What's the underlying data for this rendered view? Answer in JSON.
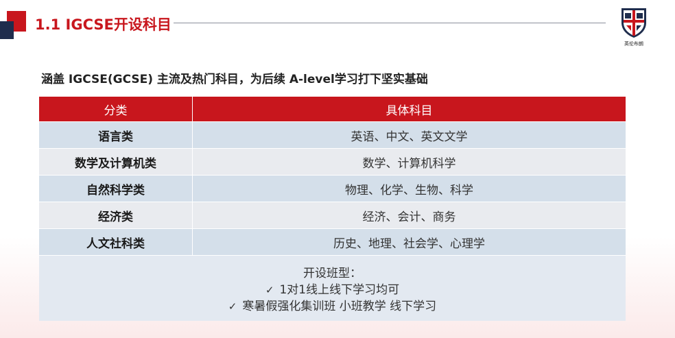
{
  "header": {
    "title": "1.1 IGCSE开设科目",
    "logo_text": "英伦布朗"
  },
  "subtitle": "涵盖 IGCSE(GCSE) 主流及热门科目，为后续 A-level学习打下坚实基础",
  "table": {
    "headers": [
      "分类",
      "具体科目"
    ],
    "rows": [
      {
        "category": "语言类",
        "subjects": "英语、中文、英文文学"
      },
      {
        "category": "数学及计算机类",
        "subjects": "数学、计算机科学"
      },
      {
        "category": "自然科学类",
        "subjects": "物理、化学、生物、科学"
      },
      {
        "category": "经济类",
        "subjects": "经济、会计、商务"
      },
      {
        "category": "人文社科类",
        "subjects": "历史、地理、社会学、心理学"
      }
    ]
  },
  "footer": {
    "title": "开设班型：",
    "items": [
      {
        "check": "✓",
        "text": "1对1线上线下学习均可"
      },
      {
        "check": "✓",
        "text": "寒暑假强化集训班 小班教学 线下学习"
      }
    ]
  },
  "colors": {
    "accent_red": "#c8161d",
    "navy": "#1f2d4d",
    "row_blue": "#d4dfea",
    "row_grey": "#e9ebef"
  }
}
